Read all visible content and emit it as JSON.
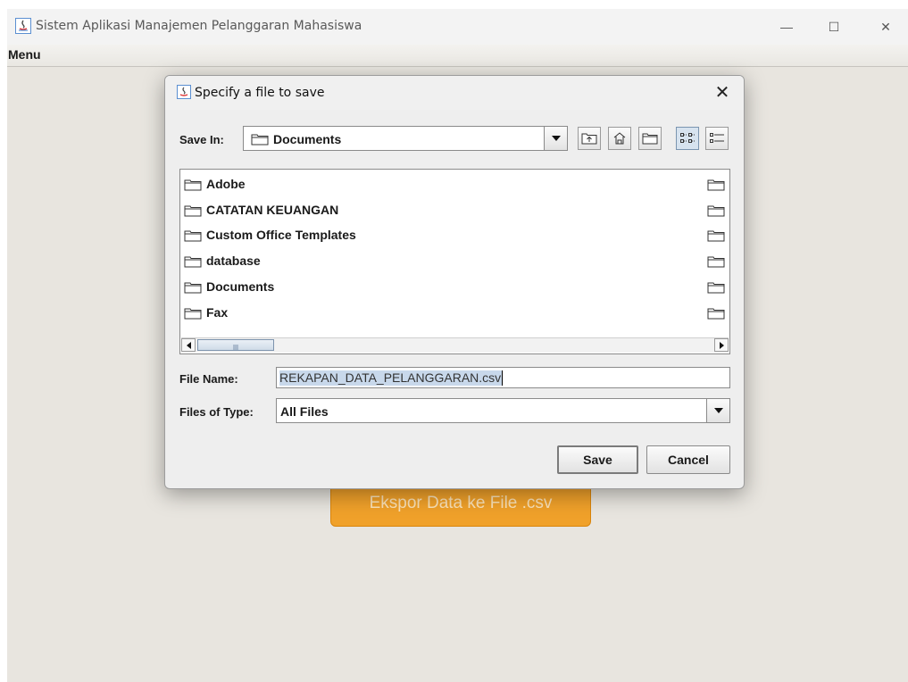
{
  "window": {
    "title": "Sistem Aplikasi Manajemen Pelanggaran Mahasiswa",
    "controls": [
      "—",
      "☐",
      "✕"
    ]
  },
  "menubar": {
    "menu_label": "Menu"
  },
  "main": {
    "export_button_label": "Ekspor Data ke File .csv"
  },
  "dialog": {
    "title": "Specify a file to save",
    "close_label": "✕",
    "save_in_label": "Save In:",
    "save_in_value": "Documents",
    "toolbar_icons": [
      "up-folder-icon",
      "home-icon",
      "new-folder-icon",
      "list-view-icon",
      "details-view-icon"
    ],
    "files": [
      {
        "name": "Adobe"
      },
      {
        "name": "CATATAN KEUANGAN"
      },
      {
        "name": "Custom Office Templates"
      },
      {
        "name": "database"
      },
      {
        "name": "Documents"
      },
      {
        "name": "Fax"
      }
    ],
    "file_name_label": "File Name:",
    "file_name_value": "REKAPAN_DATA_PELANGGARAN.csv",
    "files_of_type_label": "Files of Type:",
    "files_of_type_value": "All Files",
    "save_label": "Save",
    "cancel_label": "Cancel"
  },
  "colors": {
    "accent_button": "#f0a12a",
    "selection": "#c8d8eb",
    "background": "#e8e5df"
  }
}
